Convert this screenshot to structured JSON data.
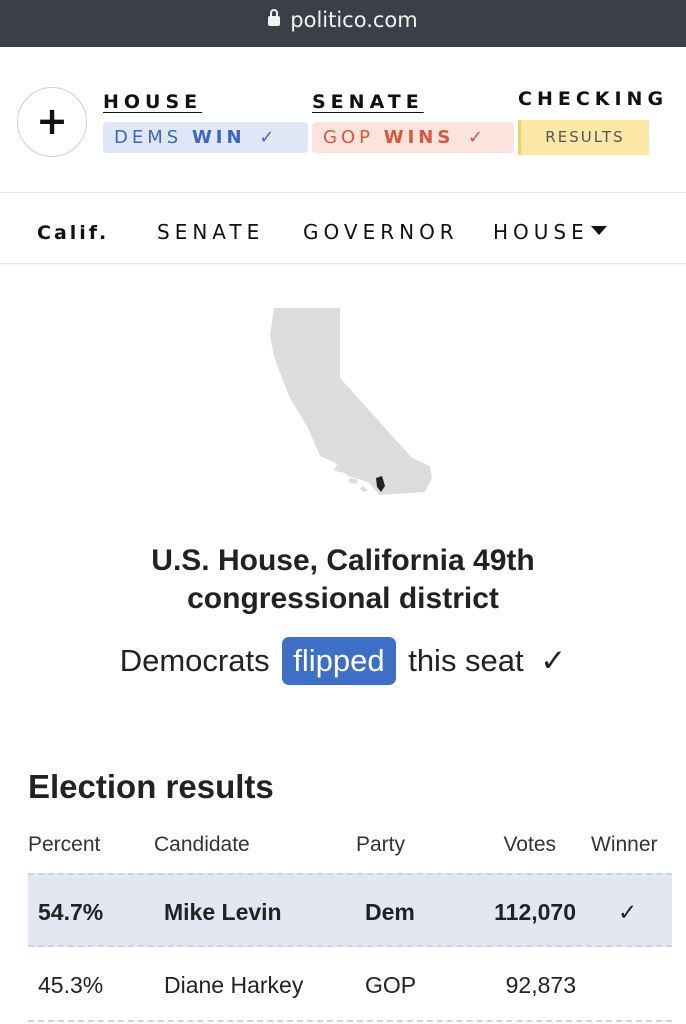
{
  "browser": {
    "domain": "politico.com"
  },
  "topnav": {
    "house_label": "HOUSE",
    "house_status_party": "DEMS",
    "house_status_result": "WIN",
    "senate_label": "SENATE",
    "senate_status_party": "GOP",
    "senate_status_result": "WINS",
    "check": "✓",
    "checking_label": "CHECKING",
    "results_button": "RESULTS",
    "plus": "+",
    "colors": {
      "dem": "#3a66c4",
      "gop": "#d9573b",
      "results": "#fbe7a6"
    }
  },
  "subnav": {
    "state": "Calif.",
    "items": [
      "SENATE",
      "GOVERNOR",
      "HOUSE"
    ]
  },
  "race": {
    "title_line1": "U.S. House, California 49th",
    "title_line2": "congressional district",
    "flip_prefix": "Democrats",
    "flip_word": "flipped",
    "flip_suffix": "this seat",
    "check": "✓"
  },
  "results": {
    "title": "Election results",
    "columns": [
      "Percent",
      "Candidate",
      "Party",
      "Votes",
      "Winner"
    ],
    "rows": [
      {
        "percent": "54.7%",
        "candidate": "Mike Levin",
        "party": "Dem",
        "votes": "112,070",
        "winner": "✓"
      },
      {
        "percent": "45.3%",
        "candidate": "Diane Harkey",
        "party": "GOP",
        "votes": "92,873",
        "winner": ""
      }
    ]
  }
}
